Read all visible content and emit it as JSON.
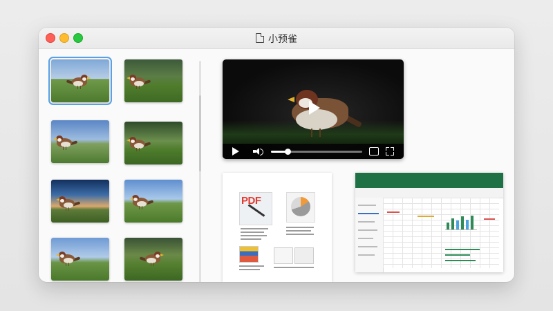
{
  "window": {
    "title": "小预雀"
  },
  "thumbnails": [
    {
      "name": "sparrow-photo-1",
      "selected": true
    },
    {
      "name": "sparrow-photo-2",
      "selected": false
    },
    {
      "name": "sparrow-photo-3",
      "selected": false
    },
    {
      "name": "sparrow-photo-4",
      "selected": false
    },
    {
      "name": "sparrow-photo-5",
      "selected": false
    },
    {
      "name": "sparrow-photo-6",
      "selected": false
    },
    {
      "name": "sparrow-photo-7",
      "selected": false
    },
    {
      "name": "sparrow-photo-8",
      "selected": false
    }
  ],
  "video": {
    "progress": 0.18
  },
  "document": {
    "pdf_label": "PDF"
  },
  "colors": {
    "accent": "#5aa0e6",
    "excel_green": "#1e7145",
    "pdf_red": "#e23b31"
  }
}
